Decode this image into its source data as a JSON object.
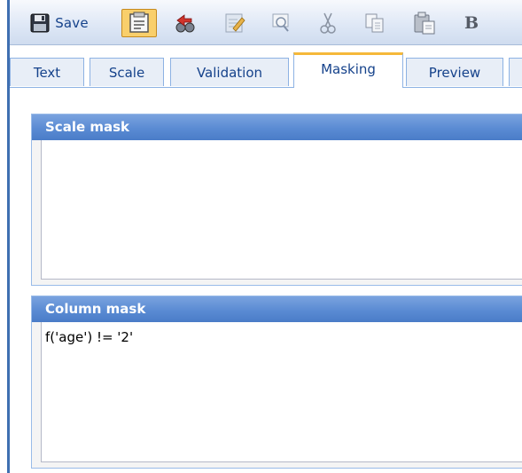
{
  "toolbar": {
    "save_label": "Save",
    "buttons": [
      {
        "icon": "save-icon"
      },
      {
        "icon": "properties-icon",
        "pressed": true
      },
      {
        "icon": "undo-icon"
      },
      {
        "icon": "edit-icon"
      },
      {
        "icon": "find-icon"
      },
      {
        "icon": "cut-icon"
      },
      {
        "icon": "copy-icon"
      },
      {
        "icon": "paste-icon"
      },
      {
        "icon": "bold-icon"
      }
    ],
    "bold_glyph": "B"
  },
  "tabs": [
    {
      "label": "Text"
    },
    {
      "label": "Scale"
    },
    {
      "label": "Validation"
    },
    {
      "label": "Masking",
      "active": true
    },
    {
      "label": "Preview"
    }
  ],
  "panels": {
    "scale_mask": {
      "title": "Scale mask",
      "value": ""
    },
    "column_mask": {
      "title": "Column mask",
      "value": "f('age') != '2'"
    }
  },
  "colors": {
    "toolbar_bg": "#dfe8f6",
    "panel_header": "#5a8bd3",
    "active_tab_accent": "#f5b83a",
    "pressed_button": "#f9cf6b"
  }
}
